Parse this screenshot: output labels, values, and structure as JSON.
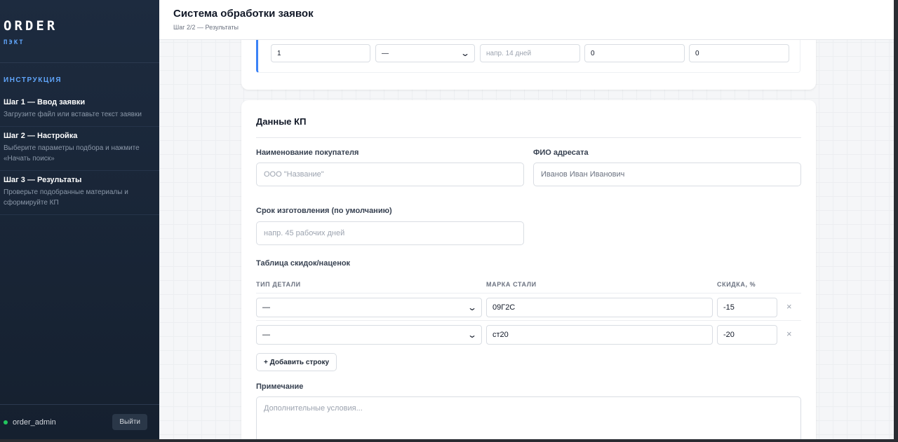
{
  "sidebar": {
    "brand": "ORDER",
    "brand_sub": "ПЭКТ",
    "instructions_header": "ИНСТРУКЦИЯ",
    "steps": [
      {
        "title": "Шаг 1 — Ввод заявки",
        "desc": "Загрузите файл или вставьте текст заявки"
      },
      {
        "title": "Шаг 2 — Настройка",
        "desc": "Выберите параметры подбора и нажмите «Начать поиск»"
      },
      {
        "title": "Шаг 3 — Результаты",
        "desc": "Проверьте подобранные материалы и сформируйте КП"
      }
    ],
    "user": "order_admin",
    "logout_label": "Выйти"
  },
  "header": {
    "title": "Система обработки заявок",
    "breadcrumb": "Шаг 2/2 — Результаты"
  },
  "position_row": {
    "quantity": "1",
    "select_value": "—",
    "lead_time_placeholder": "напр. 14 дней",
    "field4": "0",
    "field5": "0"
  },
  "kp": {
    "title": "Данные КП",
    "buyer_label": "Наименование покупателя",
    "buyer_placeholder": "ООО \"Название\"",
    "addressee_label": "ФИО адресата",
    "addressee_placeholder": "Иванов Иван Иванович",
    "lead_time_label": "Срок изготовления (по умолчанию)",
    "lead_time_placeholder": "напр. 45 рабочих дней",
    "discount_table_title": "Таблица скидок/наценок",
    "columns": [
      "ТИП ДЕТАЛИ",
      "МАРКА СТАЛИ",
      "СКИДКА, %"
    ],
    "rows": [
      {
        "part_type": "—",
        "steel_grade": "09Г2С",
        "discount": "-15"
      },
      {
        "part_type": "—",
        "steel_grade": "ст20",
        "discount": "-20"
      }
    ],
    "add_row_label": "+ Добавить строку",
    "note_label": "Примечание",
    "note_placeholder": "Дополнительные условия..."
  },
  "icons": {
    "remove": "close-icon",
    "select": "chevron-down-icon",
    "status": "online-dot"
  },
  "colors": {
    "accent": "#3b82f6",
    "sidebar_bg": "#1d2b3f",
    "online": "#22c55e"
  }
}
